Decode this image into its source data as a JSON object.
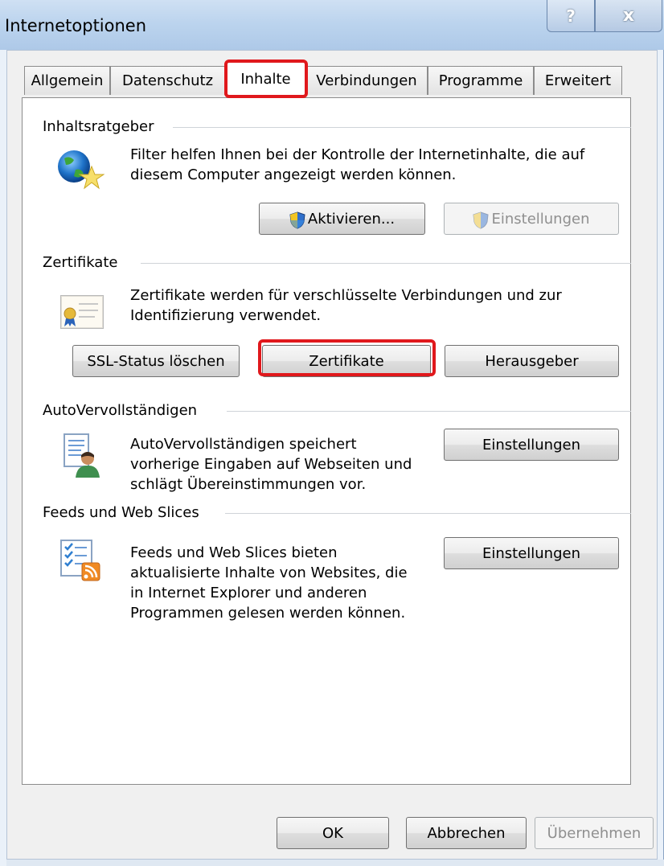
{
  "window": {
    "title": "Internetoptionen",
    "help_label": "?",
    "close_label": "x"
  },
  "tabs": [
    {
      "label": "Allgemein",
      "active": false
    },
    {
      "label": "Datenschutz",
      "active": false
    },
    {
      "label": "Inhalte",
      "active": true
    },
    {
      "label": "Verbindungen",
      "active": false
    },
    {
      "label": "Programme",
      "active": false
    },
    {
      "label": "Erweitert",
      "active": false
    }
  ],
  "content_advisor": {
    "title": "Inhaltsratgeber",
    "description_line1": "Filter helfen Ihnen bei der Kontrolle der Internetinhalte, die auf",
    "description_line2": "diesem Computer angezeigt werden können.",
    "enable_label": "Aktivieren...",
    "settings_label": "Einstellungen"
  },
  "certificates": {
    "title": "Zertifikate",
    "description_line1": "Zertifikate werden für verschlüsselte Verbindungen und zur",
    "description_line2": "Identifizierung verwendet.",
    "clear_ssl_label": "SSL-Status löschen",
    "certificates_label": "Zertifikate",
    "publishers_label": "Herausgeber"
  },
  "autocomplete": {
    "title": "AutoVervollständigen",
    "description_line1": "AutoVervollständigen speichert",
    "description_line2": "vorherige Eingaben auf Webseiten und",
    "description_line3": "schlägt Übereinstimmungen vor.",
    "settings_label": "Einstellungen"
  },
  "feeds": {
    "title": "Feeds und Web Slices",
    "description_line1": "Feeds und Web Slices bieten",
    "description_line2": "aktualisierte Inhalte von Websites, die",
    "description_line3": "in Internet Explorer und anderen",
    "description_line4": "Programmen gelesen werden können.",
    "settings_label": "Einstellungen"
  },
  "footer": {
    "ok_label": "OK",
    "cancel_label": "Abbrechen",
    "apply_label": "Übernehmen"
  },
  "colors": {
    "highlight": "#e0181c",
    "titlebar": "#bcd4ee"
  },
  "icons": {
    "content_advisor": "globe-star-icon",
    "certificates": "certificate-icon",
    "autocomplete": "document-user-icon",
    "feeds": "feed-list-icon",
    "uac": "uac-shield-icon"
  }
}
